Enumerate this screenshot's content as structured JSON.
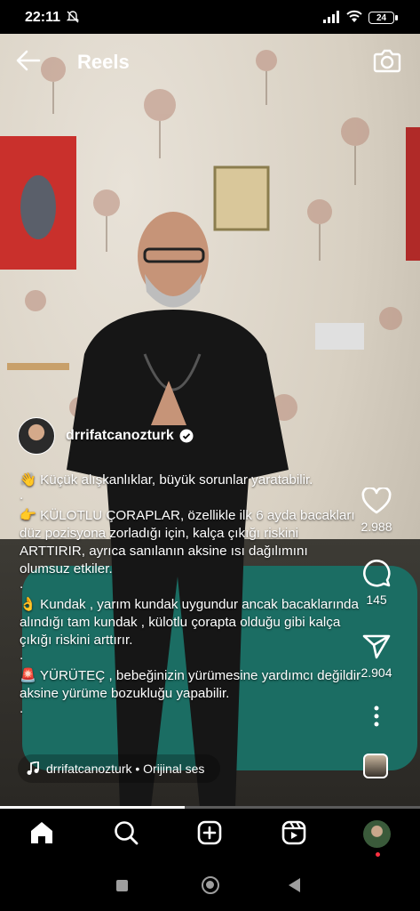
{
  "status": {
    "time": "22:11",
    "battery": "24"
  },
  "header": {
    "title": "Reels"
  },
  "author": {
    "username": "drrifatcanozturk"
  },
  "caption": [
    "👋 Küçük alışkanlıklar, büyük sorunlar yaratabilir.",
    ".",
    "👉 KÜLOTLU ÇORAPLAR, özellikle ilk 6 ayda bacakları düz pozisyona zorladığı için, kalça çıkığı riskini ARTTIRIR, ayrıca sanılanın aksine ısı dağılımını olumsuz etkiler.",
    ".",
    "👌 Kundak , yarım kundak uygundur ancak bacaklarında alındığı tam kundak , külotlu çorapta olduğu gibi kalça çıkığı riskini arttırır.",
    ".",
    "🚨 YÜRÜTEÇ , bebeğinizin yürümesine yardımcı değildir aksine yürüme bozukluğu yapabilir.",
    "."
  ],
  "audio": {
    "label": "drrifatcanozturk • Orijinal ses"
  },
  "actions": {
    "likes": "2.988",
    "comments": "145",
    "shares": "2.904"
  },
  "progress": 0.44,
  "icons": {
    "back": "arrow-left-icon",
    "camera": "camera-icon",
    "like": "heart-icon",
    "comment": "comment-icon",
    "share": "send-icon",
    "more": "more-vertical-icon",
    "home": "home-icon",
    "search": "search-icon",
    "create": "plus-square-icon",
    "reels": "reels-icon"
  }
}
